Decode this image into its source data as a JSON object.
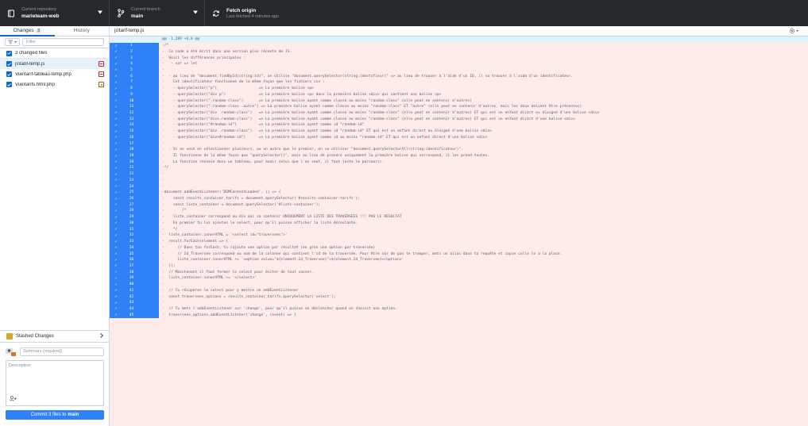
{
  "toolbar": {
    "repo": {
      "small": "Current repository",
      "main": "marieteam-web"
    },
    "branch": {
      "small": "Current branch",
      "main": "main"
    },
    "fetch": {
      "main": "Fetch origin",
      "small": "Last fetched 4 minutes ago"
    }
  },
  "sidebar": {
    "tabs": [
      {
        "label": "Changes",
        "count": "3"
      },
      {
        "label": "History"
      }
    ],
    "filter_placeholder": "Filter",
    "changed_files_label": "3 changed files",
    "files": [
      {
        "path": "js\\tarif-temp.js",
        "status": "deleted"
      },
      {
        "path": "Vue\\tarif-tableau-temp.php",
        "status": "deleted"
      },
      {
        "path": "Vue\\tarifs.html.php",
        "status": "modified"
      }
    ],
    "stashed_label": "Stashed Changes",
    "summary_placeholder": "Summary (required)",
    "description_placeholder": "Description",
    "commit_button": {
      "prefix": "Commit 3 files to",
      "branch": "main"
    }
  },
  "diff": {
    "path": "js\\tarif-temp.js",
    "hunk_header": "@@ -1,289 +0,0 @@",
    "lines": [
      {
        "n": "1",
        "text": "/*"
      },
      {
        "n": "2",
        "text": "  Ce code a été écrit dans une version plus récente de JS."
      },
      {
        "n": "3",
        "text": "  Voici les différences principales :"
      },
      {
        "n": "4",
        "text": "   - var => let"
      },
      {
        "n": "5",
        "text": ""
      },
      {
        "n": "6",
        "text": "  - au lieu de \"document.findById(string:id)\", on utilise \"document.querySelector(string:identifieur)\" => au lieu de trouver à l'aide d'un ID, il va trouver à l'aide d'un identificateur."
      },
      {
        "n": "7",
        "text": "    Cet identificateur fonctionne de la même façon que les fichiers css :"
      },
      {
        "n": "8",
        "text": "    - querySelector(\"p\")                   => La première balise <p>"
      },
      {
        "n": "9",
        "text": "    - querySelector(\"div p\")               => La première balise <p> dans la première balise <div> qui contient une balise <p>"
      },
      {
        "n": "10",
        "text": "    - querySelector(\".random-class\")       => La première balise ayant comme classe au moins \"random-class\" (elle peut en contenir d'autres)"
      },
      {
        "n": "11",
        "text": "    - querySelector(\".random-class .autre\") => La première balise ayant comme classe au moins \"random-class\" ET \"autre\" (elle peut en contenir d'autres, mais les deux doivent être présentes)"
      },
      {
        "n": "12",
        "text": "    - querySelector(\"div .random-class\")   => La première balise ayant comme classe au moins \"random-class\" (elle peut en contenir d'autres) ET qui est un enfant direct ou éloigné d'une balise <div>"
      },
      {
        "n": "13",
        "text": "    - querySelector(\"div>.random-class\")   => La première balise ayant comme classe au moins \"random-class\" (elle peut en contenir d'autres) ET qui est un enfant direct d'une balise <div>"
      },
      {
        "n": "14",
        "text": "    - querySelector(\"#random-id\")          => La première balise ayant comme id \"random-id\""
      },
      {
        "n": "15",
        "text": "    - querySelector(\"div .random-class\")   => La première balise ayant comme id \"random-id\" ET qui est un enfant direct ou éloigné d'une balise <div>"
      },
      {
        "n": "16",
        "text": "    - querySelector(\"div>#random-id\")      => La première balise ayant comme id au moins \"random-id\" ET qui est un enfant direct d'une balise <div>"
      },
      {
        "n": "17",
        "text": ""
      },
      {
        "n": "18",
        "text": "  - Si on veut en sélectionner plusieurs, ou un autre que le premier, on va utiliser \"document.querySelectorAll(string:identificateur)\"."
      },
      {
        "n": "19",
        "text": "    Il fonctionne de la même façon que \"querySelector()\", mais au lieu de prendre uniquement la première balise qui correspond, il les prend toutes."
      },
      {
        "n": "20",
        "text": "    La fonction renvoie donc un tableau, pour avoir celui que l'on veut, il faut juste le parcourir."
      },
      {
        "n": "21",
        "text": "*/"
      },
      {
        "n": "22",
        "text": ""
      },
      {
        "n": "23",
        "text": ""
      },
      {
        "n": "24",
        "text": ""
      },
      {
        "n": "25",
        "text": "document.addEventListener('DOMContentLoaded', () => {"
      },
      {
        "n": "26",
        "text": "    const results_container_tarifs = document.querySelector('#results-container-tarifs');"
      },
      {
        "n": "27",
        "text": "    const liste_container = document.querySelector('#liste-container');"
      },
      {
        "n": "28",
        "text": "        /*"
      },
      {
        "n": "29",
        "text": "    liste_container correspond au div qui va contenir UNIQUEMENT LA LISTE DES TRAVERSÉES !!! PAS LE RÉSULTAT"
      },
      {
        "n": "30",
        "text": "    En premier tu lui ajoutes le select, pour qu'il puisse afficher la liste déroulante."
      },
      {
        "n": "31",
        "text": "    */"
      },
      {
        "n": "32",
        "text": "  liste_container.innerHTML = '<select id=\"traversees\">'"
      },
      {
        "n": "33",
        "text": "  result.forEach(element => {"
      },
      {
        "n": "34",
        "text": "      // Dans ton forEach, tu rajoute une option par résultat (en gros une option par traversée)"
      },
      {
        "n": "35",
        "text": "      // Id_Traversee correspond au nom de la colonne qui contient l'id de la traversée. Pour être sûr de pas te tromper, mets un alias dans ta requête et copie colle le à la place."
      },
      {
        "n": "36",
        "text": "      liste_container.innerHTML += `<option value=\"${element.Id_Traversee}\">${element.Id_Traversee}</option>`"
      },
      {
        "n": "37",
        "text": "  });"
      },
      {
        "n": "38",
        "text": "  // Maintenant il faut fermer le select pour éviter de tout casser."
      },
      {
        "n": "39",
        "text": "  liste_container.innerHTML += '</select>'"
      },
      {
        "n": "40",
        "text": ""
      },
      {
        "n": "41",
        "text": "  // Tu récupères le select pour y mettre un addEventListener"
      },
      {
        "n": "42",
        "text": "  const traversees_options = results_container_tarifs.querySelector('select');"
      },
      {
        "n": "43",
        "text": ""
      },
      {
        "n": "44",
        "text": "  // Tu mets l'addEventListener sur 'change', pour qu'il puisse se déclencher quand on choisit une option."
      },
      {
        "n": "45",
        "text": "  traversees_options.addEventListener('change', (event) => {"
      }
    ]
  }
}
